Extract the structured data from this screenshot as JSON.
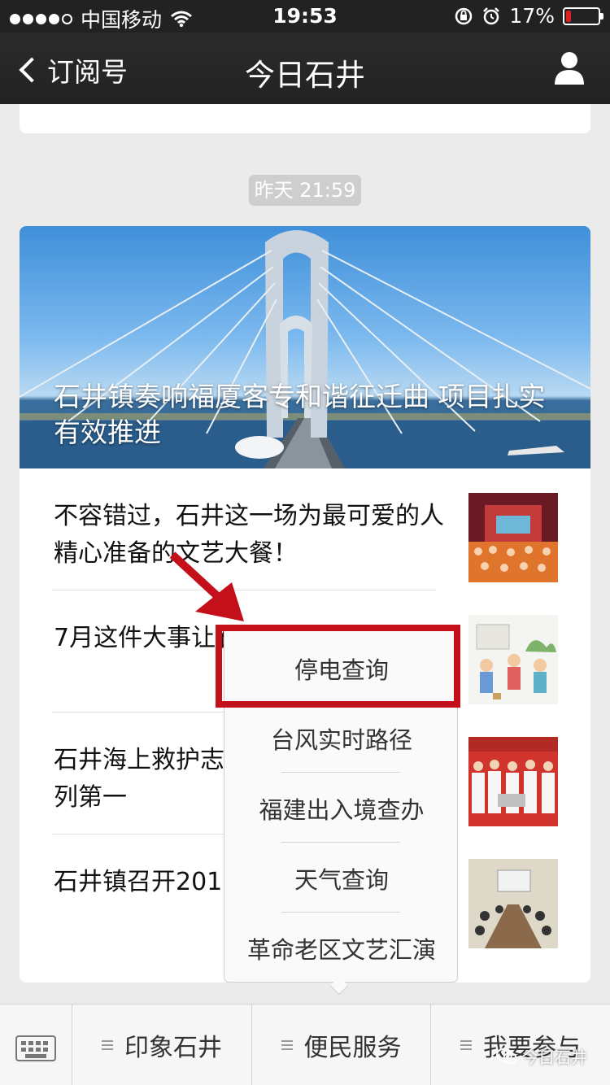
{
  "status_bar": {
    "carrier": "中国移动",
    "time": "19:53",
    "battery_pct": "17%",
    "battery_level": 0.17
  },
  "nav": {
    "back_label": "订阅号",
    "title": "今日石井"
  },
  "timestamp": "昨天 21:59",
  "feature": {
    "title": "石井镇奏响福厦客专和谐征迁曲 项目扎实有效推进"
  },
  "articles": [
    {
      "title": "不容错过，石井这一场为最可爱的人精心准备的文艺大餐！"
    },
    {
      "title": "7月这件大事让石井和美村并列第一"
    },
    {
      "title": "石井海上救护志愿队荣获泉州大赛名列第一"
    },
    {
      "title": "石井镇召开201 作会"
    }
  ],
  "popup_menu": {
    "items": [
      "停电查询",
      "台风实时路径",
      "福建出入境查办",
      "天气查询",
      "革命老区文艺汇演"
    ],
    "highlighted_index": 0,
    "highlight_color": "#c4101a"
  },
  "bottom_bar": {
    "tabs": [
      "印象石井",
      "便民服务",
      "我要参与"
    ]
  },
  "watermark": "今日石井"
}
